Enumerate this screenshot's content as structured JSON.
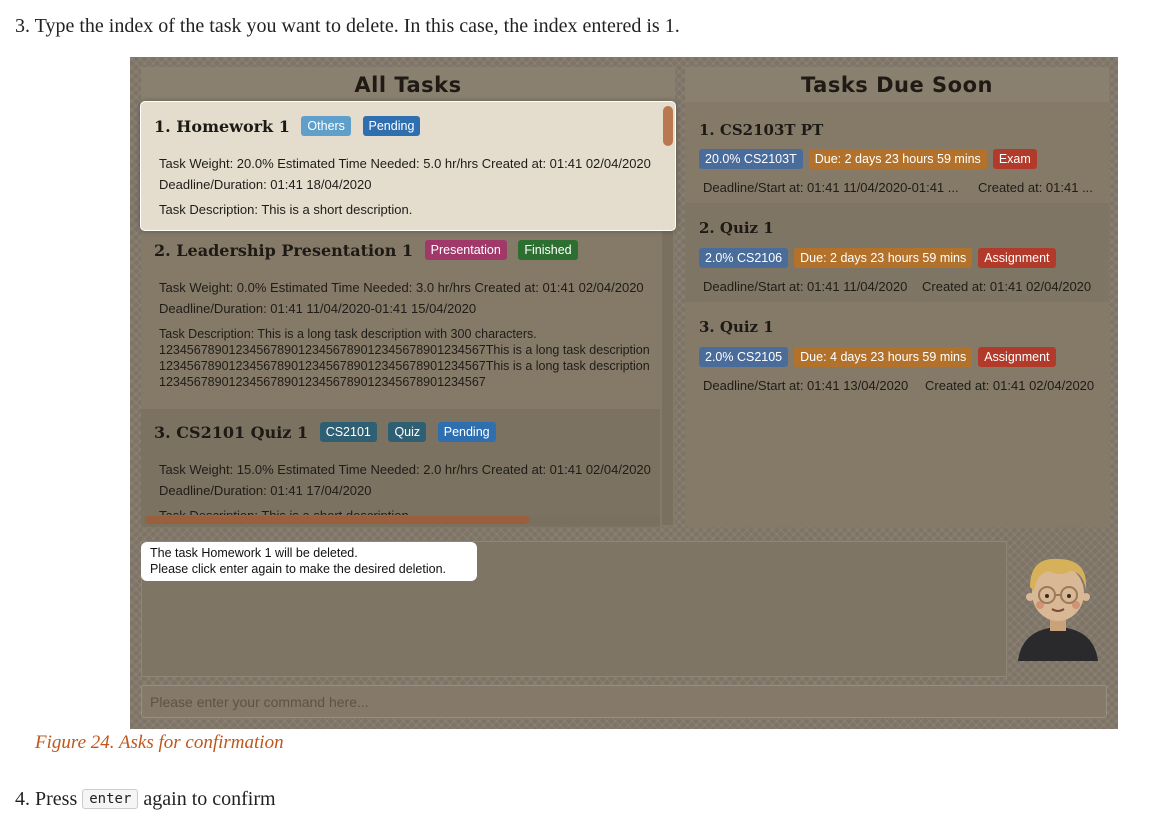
{
  "doc": {
    "step3_text": "3. Type the index of the task you want to delete. In this case, the index entered is 1.",
    "caption": "Figure 24. Asks for confirmation",
    "step4_prefix": "4. Press",
    "step4_code": "enter",
    "step4_suffix": "again to confirm"
  },
  "app": {
    "all_tasks_title": "All Tasks",
    "due_soon_title": "Tasks Due Soon",
    "tasks": [
      {
        "name": "1. Homework 1",
        "tags": [
          "Others",
          "Pending"
        ],
        "details": "Task Weight: 20.0%   Estimated Time Needed: 5.0 hr/hrs   Created at: 01:41 02/04/2020",
        "deadline": "Deadline/Duration: 01:41 18/04/2020",
        "description": "Task Description: This is a short description."
      },
      {
        "name": "2. Leadership Presentation 1",
        "tags": [
          "Presentation",
          "Finished"
        ],
        "details": "Task Weight: 0.0%   Estimated Time Needed: 3.0 hr/hrs   Created at: 01:41 02/04/2020",
        "deadline": "Deadline/Duration: 01:41 11/04/2020-01:41 15/04/2020",
        "description_lines": [
          "Task Description: This is a long task description with 300 characters.",
          "12345678901234567890123456789012345678901234567This is a long task description",
          "12345678901234567890123456789012345678901234567This is a long task description",
          "12345678901234567890123456789012345678901234567"
        ]
      },
      {
        "name": "3. CS2101 Quiz 1",
        "tags": [
          "CS2101",
          "Quiz",
          "Pending"
        ],
        "details": "Task Weight: 15.0%   Estimated Time Needed: 2.0 hr/hrs   Created at: 01:41 02/04/2020",
        "deadline": "Deadline/Duration: 01:41 17/04/2020",
        "description": "Task Description: This is a short description."
      }
    ],
    "due_soon": [
      {
        "name": "1. CS2103T PT",
        "badges": [
          "20.0% CS2103T",
          "Due: 2 days 23 hours 59 mins",
          "Exam"
        ],
        "deadline": "Deadline/Start at: 01:41 11/04/2020-01:41 ...",
        "created": "Created at: 01:41 ..."
      },
      {
        "name": "2. Quiz 1",
        "badges": [
          "2.0% CS2106",
          "Due: 2 days 23 hours 59 mins",
          "Assignment"
        ],
        "deadline": "Deadline/Start at: 01:41 11/04/2020",
        "created": "Created at: 01:41 02/04/2020"
      },
      {
        "name": "3. Quiz 1",
        "badges": [
          "2.0% CS2105",
          "Due: 4 days 23 hours 59 mins",
          "Assignment"
        ],
        "deadline": "Deadline/Start at: 01:41 13/04/2020",
        "created": "Created at: 01:41 02/04/2020"
      }
    ],
    "result_line1": "The task Homework 1 will be deleted.",
    "result_line2": "Please click enter again to make the desired deletion.",
    "command_placeholder": "Please enter your command here...",
    "colors": {
      "accent_orange": "#c0561b",
      "background": "#7d7466",
      "selected_card": "#e4dccd"
    },
    "icons": {
      "avatar": "avatar-icon"
    }
  }
}
